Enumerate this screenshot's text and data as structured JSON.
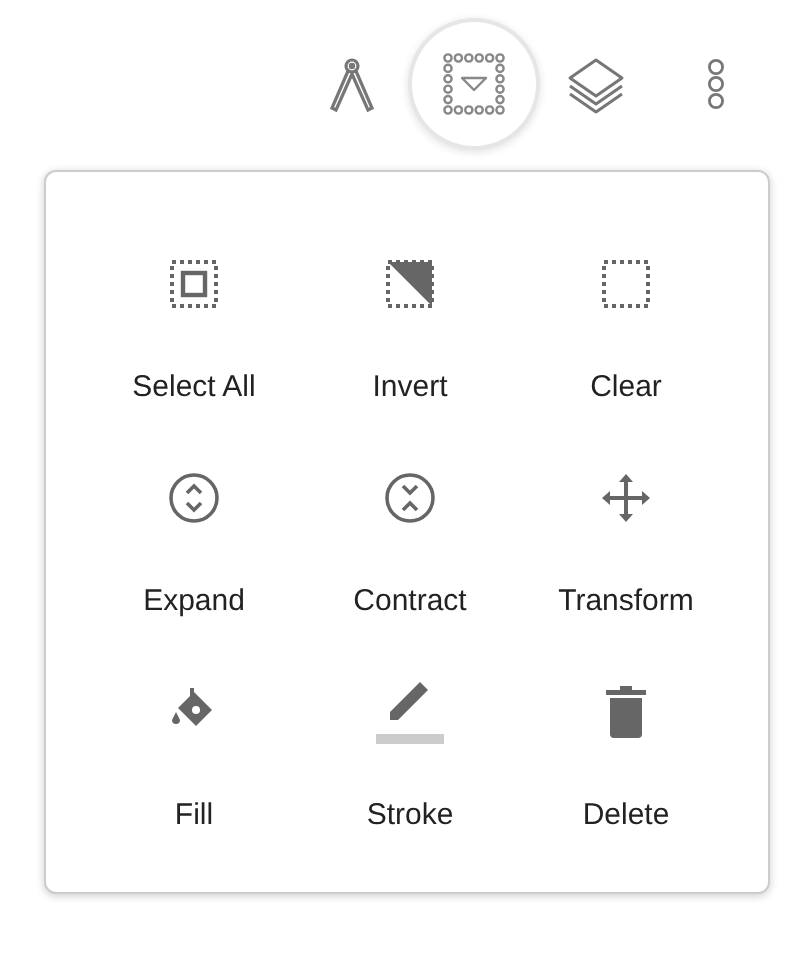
{
  "toolbar": [
    {
      "kind": "compass",
      "selected": false
    },
    {
      "kind": "selection",
      "selected": true
    },
    {
      "kind": "layers",
      "selected": false
    },
    {
      "kind": "more",
      "selected": false
    }
  ],
  "menu": {
    "items": [
      {
        "label": "Select All",
        "kind": "select-all"
      },
      {
        "label": "Invert",
        "kind": "invert"
      },
      {
        "label": "Clear",
        "kind": "clear"
      },
      {
        "label": "Expand",
        "kind": "expand"
      },
      {
        "label": "Contract",
        "kind": "contract"
      },
      {
        "label": "Transform",
        "kind": "transform"
      },
      {
        "label": "Fill",
        "kind": "fill"
      },
      {
        "label": "Stroke",
        "kind": "stroke"
      },
      {
        "label": "Delete",
        "kind": "delete"
      }
    ]
  }
}
